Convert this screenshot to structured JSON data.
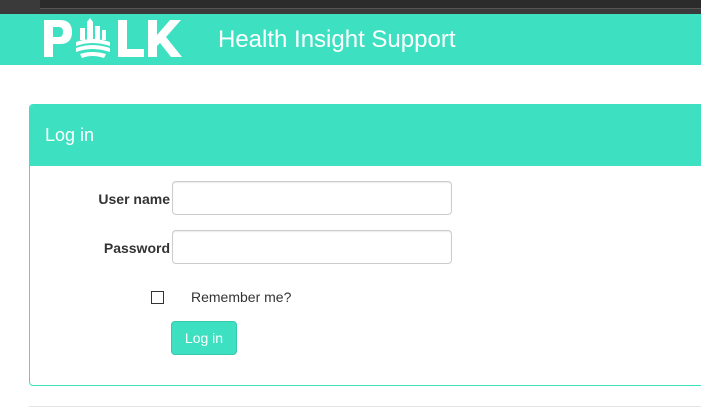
{
  "header": {
    "brand_logo": "POLK",
    "site_title": "Health Insight Support",
    "background_color": "#3de0c1"
  },
  "login_panel": {
    "title": "Log in",
    "username_label": "User name",
    "username_value": "",
    "password_label": "Password",
    "password_value": "",
    "remember_label": "Remember me?",
    "remember_checked": false,
    "submit_label": "Log in",
    "accent_color": "#3de0c1"
  },
  "icons": {
    "logo": "polk-logo-icon",
    "checkbox": "checkbox-unchecked"
  }
}
